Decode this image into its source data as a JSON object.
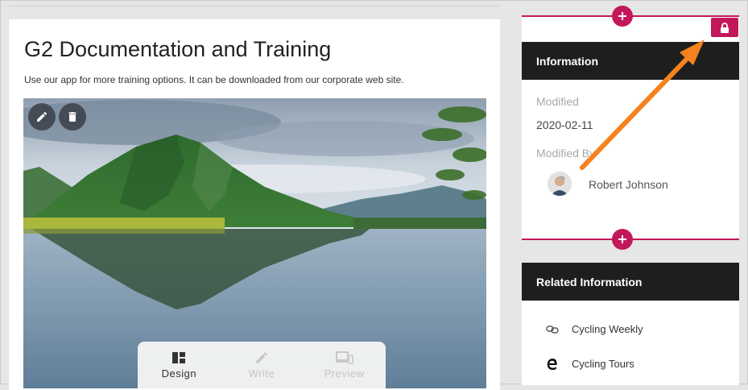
{
  "main": {
    "title": "G2 Documentation and Training",
    "description": "Use our app for more training options. It can be downloaded from our corporate web site.",
    "modes": [
      {
        "label": "Design",
        "icon": "dashboard-icon",
        "state": "active"
      },
      {
        "label": "Write",
        "icon": "pencil-icon",
        "state": "disabled"
      },
      {
        "label": "Preview",
        "icon": "devices-icon",
        "state": "disabled"
      }
    ]
  },
  "information": {
    "header": "Information",
    "modified_label": "Modified",
    "modified_value": "2020-02-11",
    "modified_by_label": "Modified By",
    "modified_by_name": "Robert Johnson"
  },
  "related": {
    "header": "Related Information",
    "items": [
      {
        "label": "Cycling Weekly",
        "icon": "link-icon"
      },
      {
        "label": "Cycling Tours",
        "icon": "edge-icon"
      }
    ]
  },
  "colors": {
    "accent": "#c2185b",
    "header_bg": "#1e1e1e",
    "annotation_arrow": "#f5821f"
  }
}
